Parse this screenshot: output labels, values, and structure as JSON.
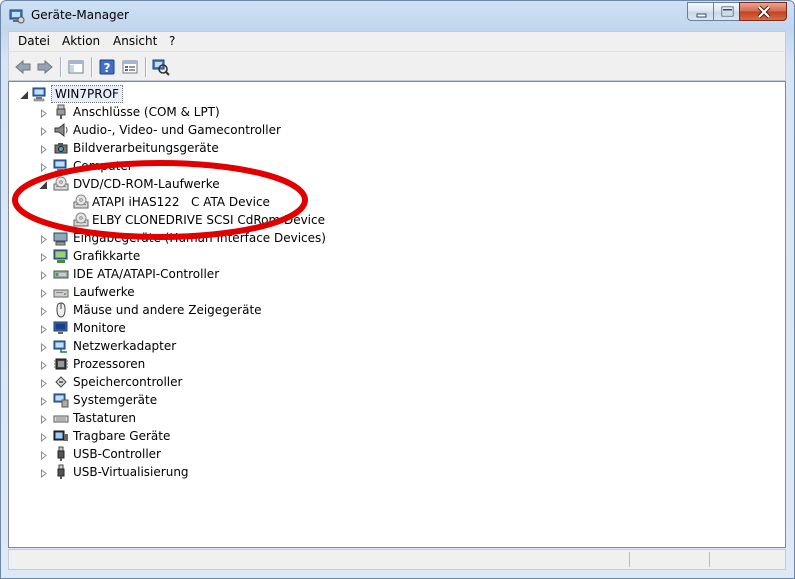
{
  "window": {
    "title": "Geräte-Manager"
  },
  "menu": [
    {
      "label": "Datei"
    },
    {
      "label": "Aktion"
    },
    {
      "label": "Ansicht"
    },
    {
      "label": "?"
    }
  ],
  "toolbar": [
    {
      "icon": "back-arrow-icon"
    },
    {
      "icon": "forward-arrow-icon"
    },
    {
      "icon": "show-hide-console-tree-icon"
    },
    {
      "icon": "help-icon"
    },
    {
      "icon": "properties-icon"
    },
    {
      "icon": "scan-hardware-icon"
    }
  ],
  "tree": {
    "root": {
      "label": "WIN7PROF",
      "icon": "computer-icon"
    },
    "categories": [
      {
        "label": "Anschlüsse (COM & LPT)",
        "icon": "port-icon"
      },
      {
        "label": "Audio-, Video- und Gamecontroller",
        "icon": "speaker-icon"
      },
      {
        "label": "Bildverarbeitungsgeräte",
        "icon": "camera-icon"
      },
      {
        "label": "Computer",
        "icon": "computer-icon"
      },
      {
        "label": "DVD/CD-ROM-Laufwerke",
        "icon": "dvd-drive-icon",
        "expanded": true,
        "children": [
          {
            "label": "ATAPI iHAS122   C ATA Device",
            "icon": "dvd-drive-icon"
          },
          {
            "label": "ELBY CLONEDRIVE SCSI CdRom Device",
            "icon": "dvd-drive-icon"
          }
        ]
      },
      {
        "label": "Eingabegeräte (Human Interface Devices)",
        "icon": "hid-icon"
      },
      {
        "label": "Grafikkarte",
        "icon": "display-adapter-icon"
      },
      {
        "label": "IDE ATA/ATAPI-Controller",
        "icon": "ide-controller-icon"
      },
      {
        "label": "Laufwerke",
        "icon": "disk-drive-icon"
      },
      {
        "label": "Mäuse und andere Zeigegeräte",
        "icon": "mouse-icon"
      },
      {
        "label": "Monitore",
        "icon": "monitor-icon"
      },
      {
        "label": "Netzwerkadapter",
        "icon": "network-adapter-icon"
      },
      {
        "label": "Prozessoren",
        "icon": "processor-icon"
      },
      {
        "label": "Speichercontroller",
        "icon": "storage-controller-icon"
      },
      {
        "label": "Systemgeräte",
        "icon": "system-devices-icon"
      },
      {
        "label": "Tastaturen",
        "icon": "keyboard-icon"
      },
      {
        "label": "Tragbare Geräte",
        "icon": "portable-device-icon"
      },
      {
        "label": "USB-Controller",
        "icon": "usb-icon"
      },
      {
        "label": "USB-Virtualisierung",
        "icon": "usb-icon"
      }
    ]
  },
  "colors": {
    "highlight_ellipse": "#e00000",
    "title_gradient": "#c1d6ee"
  }
}
